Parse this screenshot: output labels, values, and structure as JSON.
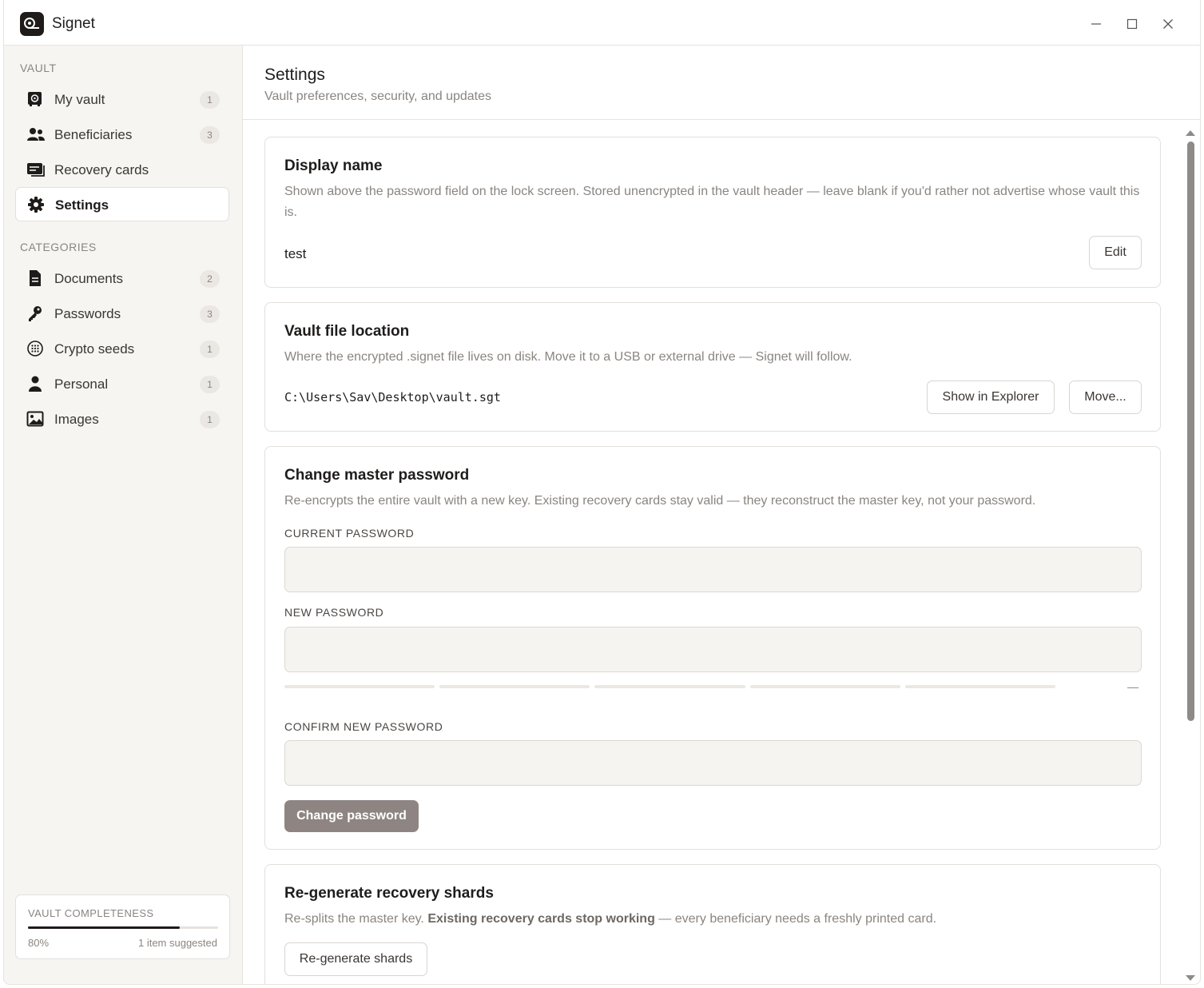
{
  "window": {
    "title": "Signet",
    "controls": [
      "minimize",
      "maximize",
      "close"
    ]
  },
  "sidebar": {
    "vault_label": "VAULT",
    "vault_items": [
      {
        "label": "My vault",
        "count": "1",
        "icon": "safe-icon"
      },
      {
        "label": "Beneficiaries",
        "count": "3",
        "icon": "people-icon"
      },
      {
        "label": "Recovery cards",
        "count": "",
        "icon": "cards-icon"
      },
      {
        "label": "Settings",
        "count": "",
        "icon": "gear-icon",
        "active": true
      }
    ],
    "categories_label": "CATEGORIES",
    "category_items": [
      {
        "label": "Documents",
        "count": "2",
        "icon": "document-icon"
      },
      {
        "label": "Passwords",
        "count": "3",
        "icon": "key-icon"
      },
      {
        "label": "Crypto seeds",
        "count": "1",
        "icon": "seed-grid-icon"
      },
      {
        "label": "Personal",
        "count": "1",
        "icon": "person-icon"
      },
      {
        "label": "Images",
        "count": "1",
        "icon": "image-icon"
      }
    ],
    "completeness": {
      "title": "VAULT COMPLETENESS",
      "progress": 0.8,
      "percent_label": "80%",
      "suggested": "1 item suggested"
    }
  },
  "header": {
    "title": "Settings",
    "subtitle": "Vault preferences, security, and updates"
  },
  "display_name": {
    "title": "Display name",
    "description": "Shown above the password field on the lock screen. Stored unencrypted in the vault header — leave blank if you'd rather not advertise whose vault this is.",
    "value": "test",
    "edit_label": "Edit"
  },
  "vault_location": {
    "title": "Vault file location",
    "description": "Where the encrypted .signet file lives on disk. Move it to a USB or external drive — Signet will follow.",
    "path": "C:\\Users\\Sav\\Desktop\\vault.sgt",
    "show_label": "Show in Explorer",
    "move_label": "Move..."
  },
  "change_password": {
    "title": "Change master password",
    "description": "Re-encrypts the entire vault with a new key. Existing recovery cards stay valid — they reconstruct the master key, not your password.",
    "current_label": "CURRENT PASSWORD",
    "current_value": "",
    "new_label": "NEW PASSWORD",
    "new_value": "",
    "strength_text": "—",
    "confirm_label": "CONFIRM NEW PASSWORD",
    "confirm_value": "",
    "submit_label": "Change password"
  },
  "regenerate": {
    "title": "Re-generate recovery shards",
    "desc_before": "Re-splits the master key. ",
    "desc_bold": "Existing recovery cards stop working",
    "desc_after": " — every beneficiary needs a freshly printed card.",
    "button_label": "Re-generate shards"
  }
}
